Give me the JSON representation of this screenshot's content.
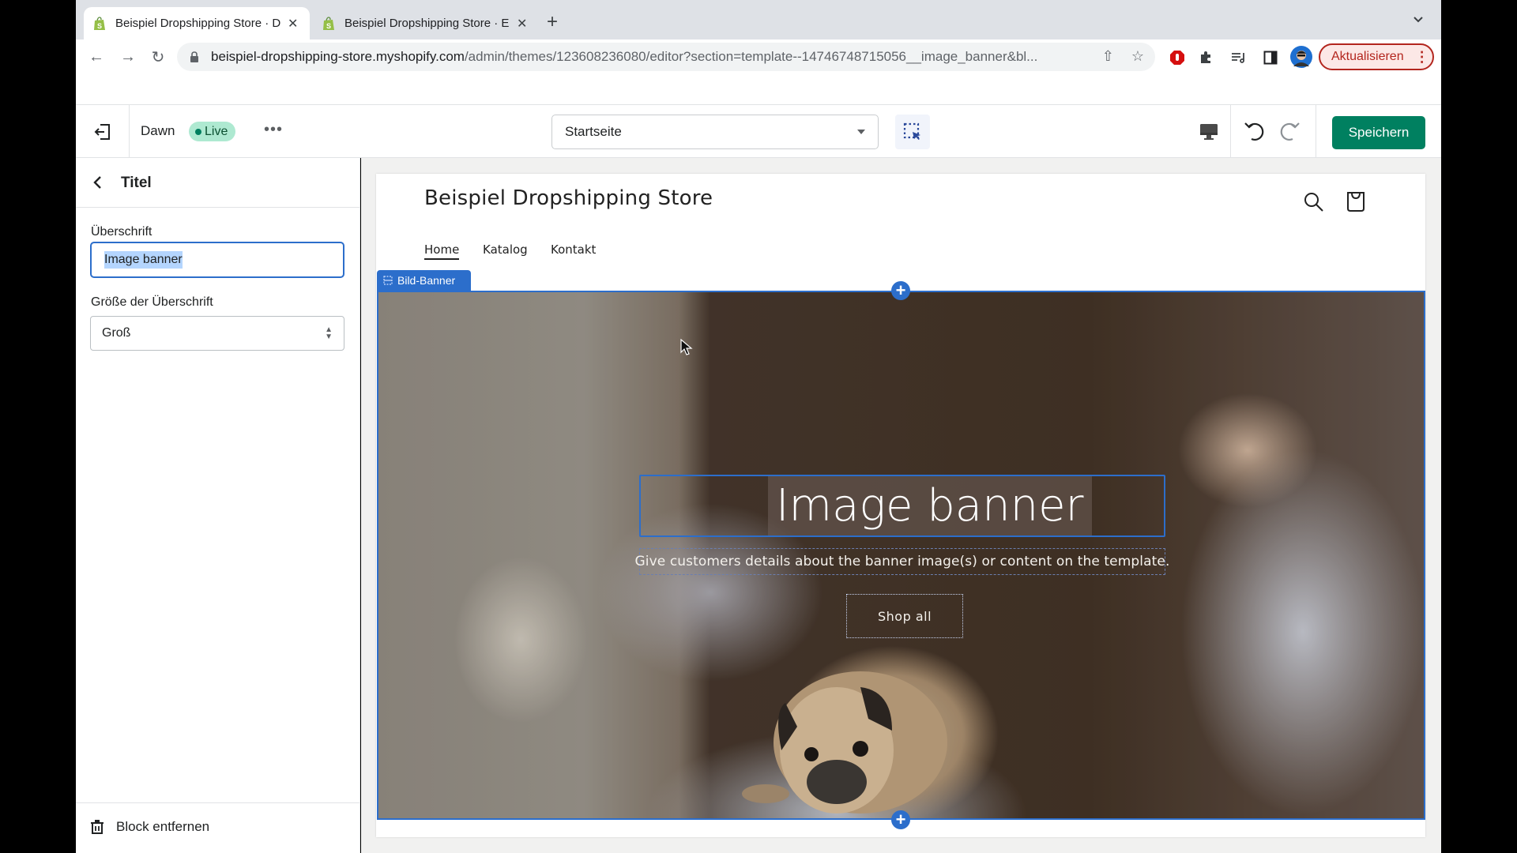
{
  "browser": {
    "tabs": [
      {
        "title": "Beispiel Dropshipping Store · D",
        "active": true
      },
      {
        "title": "Beispiel Dropshipping Store · E",
        "active": false
      }
    ],
    "new_tab_label": "+",
    "url_host": "beispiel-dropshipping-store.myshopify.com",
    "url_path": "/admin/themes/123608236080/editor?section=template--14746748715056__image_banner&bl...",
    "update_button": "Aktualisieren",
    "icons": [
      "back-icon",
      "forward-icon",
      "reload-icon",
      "lock-icon",
      "share-icon",
      "star-icon",
      "adblock-icon",
      "extensions-icon",
      "media-icon",
      "sidepanel-icon",
      "profile-avatar",
      "kebab-icon"
    ]
  },
  "editor": {
    "theme_name": "Dawn",
    "live_badge": "Live",
    "more_label": "•••",
    "page_select": "Startseite",
    "save_label": "Speichern"
  },
  "sidebar": {
    "title": "Titel",
    "heading_label": "Überschrift",
    "heading_value": "Image banner",
    "size_label": "Größe der Überschrift",
    "size_value": "Groß",
    "remove_label": "Block entfernen"
  },
  "preview": {
    "store_name": "Beispiel Dropshipping Store",
    "nav": [
      "Home",
      "Katalog",
      "Kontakt"
    ],
    "section_tag": "Bild-Banner",
    "banner_heading": "Image banner",
    "banner_description": "Give customers details about the banner image(s) or content on the template.",
    "banner_button": "Shop all",
    "accent_color": "#2c6ecb"
  },
  "colors": {
    "save_button": "#008060",
    "live_badge_bg": "#aee9d1",
    "selection_blue": "#2c6ecb",
    "update_button": "#b3261e"
  }
}
